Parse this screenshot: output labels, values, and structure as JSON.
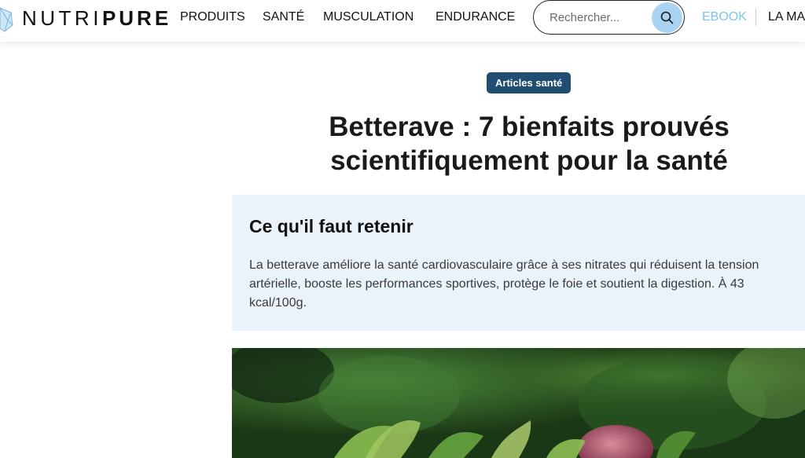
{
  "header": {
    "logo": {
      "light": "NUTRI",
      "bold": "PURE"
    },
    "nav": [
      "PRODUITS",
      "SANTÉ",
      "MUSCULATION",
      "ENDURANCE"
    ],
    "search_placeholder": "Rechercher...",
    "ebook": "EBOOK",
    "more": "LA MA"
  },
  "article": {
    "category": "Articles santé",
    "title": "Betterave : 7 bienfaits prouvés scientifiquement pour la santé",
    "summary": {
      "heading": "Ce qu'il faut retenir",
      "text": "La betterave améliore la santé cardiovasculaire grâce à ses nitrates qui réduisent la tension artérielle, booste les performances sportives, protège le foie et soutient la digestion. À 43 kcal/100g."
    }
  },
  "colors": {
    "accent": "#1f4e72",
    "search_button": "#a9d3f0",
    "ebook": "#7cc4ee",
    "summary_bg": "#eaf2fa"
  },
  "icons": [
    "leaf-logo-icon",
    "search-icon"
  ]
}
